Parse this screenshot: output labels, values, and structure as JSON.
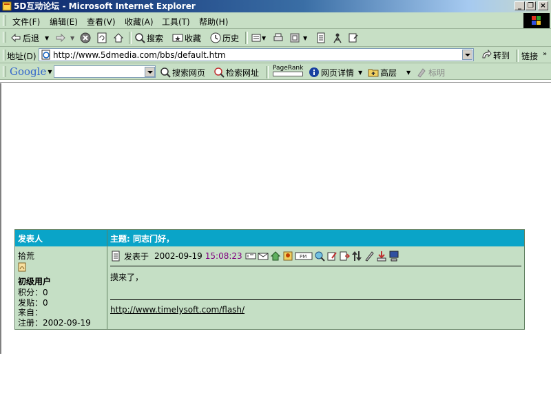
{
  "window": {
    "title": "5D互动论坛 - Microsoft Internet Explorer"
  },
  "menu": {
    "items": [
      "文件(F)",
      "编辑(E)",
      "查看(V)",
      "收藏(A)",
      "工具(T)",
      "帮助(H)"
    ]
  },
  "toolbar": {
    "back": "后退",
    "search": "搜索",
    "favorites": "收藏",
    "history": "历史"
  },
  "address": {
    "label": "地址(D)",
    "url": "http://www.5dmedia.com/bbs/default.htm",
    "go": "转到",
    "links": "链接"
  },
  "google": {
    "logo": "Google",
    "search_web": "搜索网页",
    "search_site": "检索网址",
    "pagerank": "PageRank",
    "page_info": "网页详情",
    "up": "高层",
    "highlight": "标明"
  },
  "forum": {
    "header_author": "发表人",
    "header_subject": "主题: 同志门好，",
    "author": {
      "name": "拾荒",
      "rank": "初级用户",
      "points": "积分：0",
      "posts": "发贴：0",
      "from": "来自：",
      "registered": "注册：2002-09-19"
    },
    "post": {
      "label": "发表于",
      "date": "2002-09-19",
      "time": "15:08:23",
      "body": "摸来了，",
      "signature": "http://www.timelysoft.com/flash/"
    }
  },
  "colors": {
    "chrome": "#c7dfc5",
    "table_header": "#0aa4c8",
    "table_body": "#c5dfc5",
    "time": "#800080"
  }
}
